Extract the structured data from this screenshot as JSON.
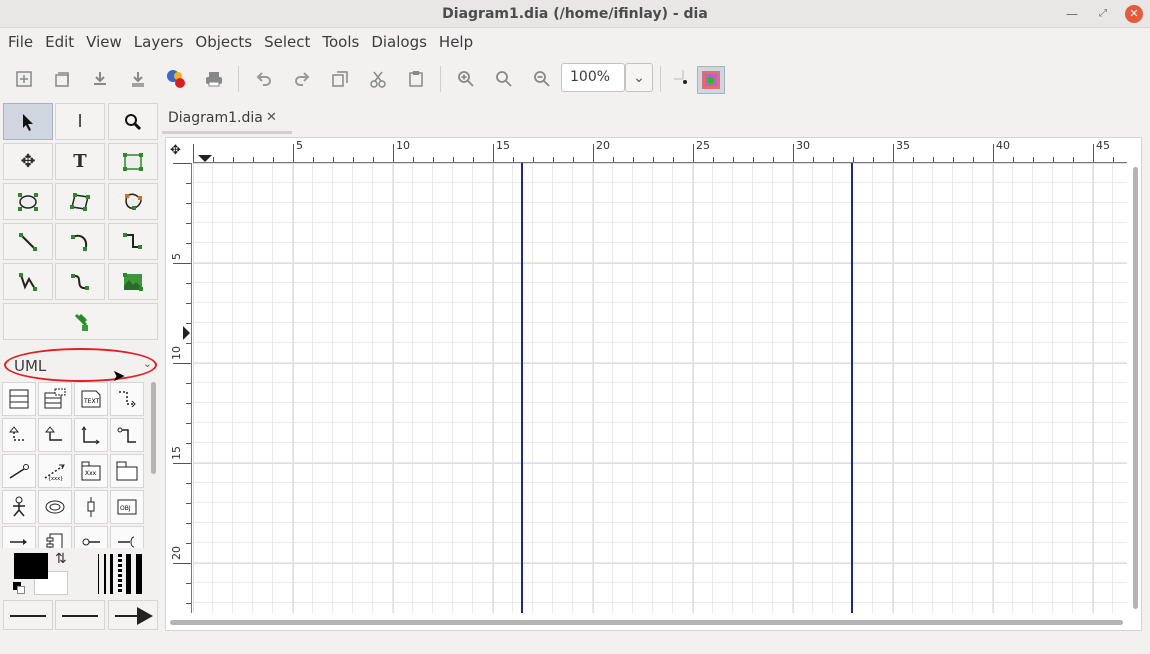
{
  "window": {
    "title": "Diagram1.dia (/home/ifinlay) - dia"
  },
  "menu": [
    "File",
    "Edit",
    "View",
    "Layers",
    "Objects",
    "Select",
    "Tools",
    "Dialogs",
    "Help"
  ],
  "toolbar": {
    "zoom_value": "100%"
  },
  "toolbox": {
    "sheet_selected": "UML",
    "shapes": [
      "Class",
      "Template class",
      "Note",
      "Dependency",
      "Realizes",
      "Generalization",
      "Association",
      "Implements",
      "Constraint",
      "Small package",
      "Large package",
      "Actor",
      "Use case",
      "Lifeline",
      "Object",
      "Message",
      "Component",
      "Node",
      "Branch"
    ],
    "colors": {
      "foreground": "#000000",
      "background": "#ffffff"
    }
  },
  "tab": {
    "label": "Diagram1.dia"
  },
  "rulers": {
    "horizontal": [
      "5",
      "10",
      "15",
      "20",
      "25",
      "30",
      "35",
      "40",
      "45"
    ],
    "vertical": [
      "5",
      "10",
      "15",
      "20"
    ]
  },
  "colors": {
    "guide": "#1e2a80",
    "close_button": "#e35b3c",
    "selection_highlight": "#e02020"
  }
}
